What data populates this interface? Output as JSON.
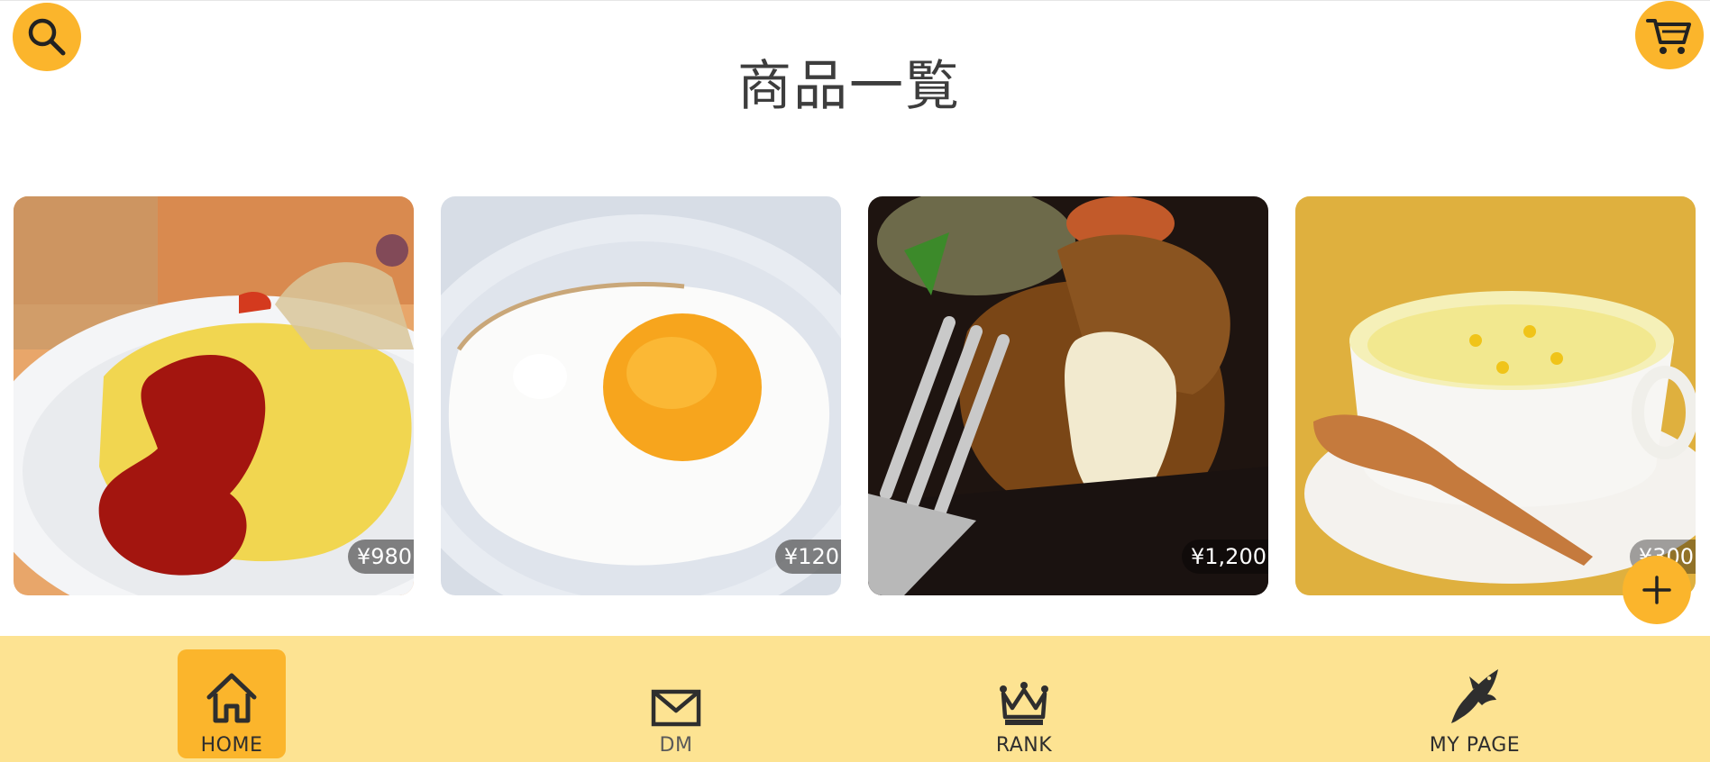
{
  "header": {
    "title": "商品一覧",
    "search_icon": "search-icon",
    "cart_icon": "cart-icon"
  },
  "products": [
    {
      "name": "omelette-rice",
      "price": "¥980"
    },
    {
      "name": "fried-egg",
      "price": "¥120"
    },
    {
      "name": "hamburg-steak",
      "price": "¥1,200"
    },
    {
      "name": "corn-soup",
      "price": "¥300"
    }
  ],
  "fab": {
    "icon": "plus-icon"
  },
  "nav": {
    "items": [
      {
        "label": "HOME",
        "icon": "home-icon",
        "active": true
      },
      {
        "label": "DM",
        "icon": "mail-icon",
        "active": false
      },
      {
        "label": "RANK",
        "icon": "crown-icon",
        "active": false
      },
      {
        "label": "MY PAGE",
        "icon": "shark-icon",
        "active": false
      }
    ]
  },
  "colors": {
    "accent": "#fbb52c",
    "nav_background": "#fde392",
    "title_text": "#3d3d3d"
  }
}
